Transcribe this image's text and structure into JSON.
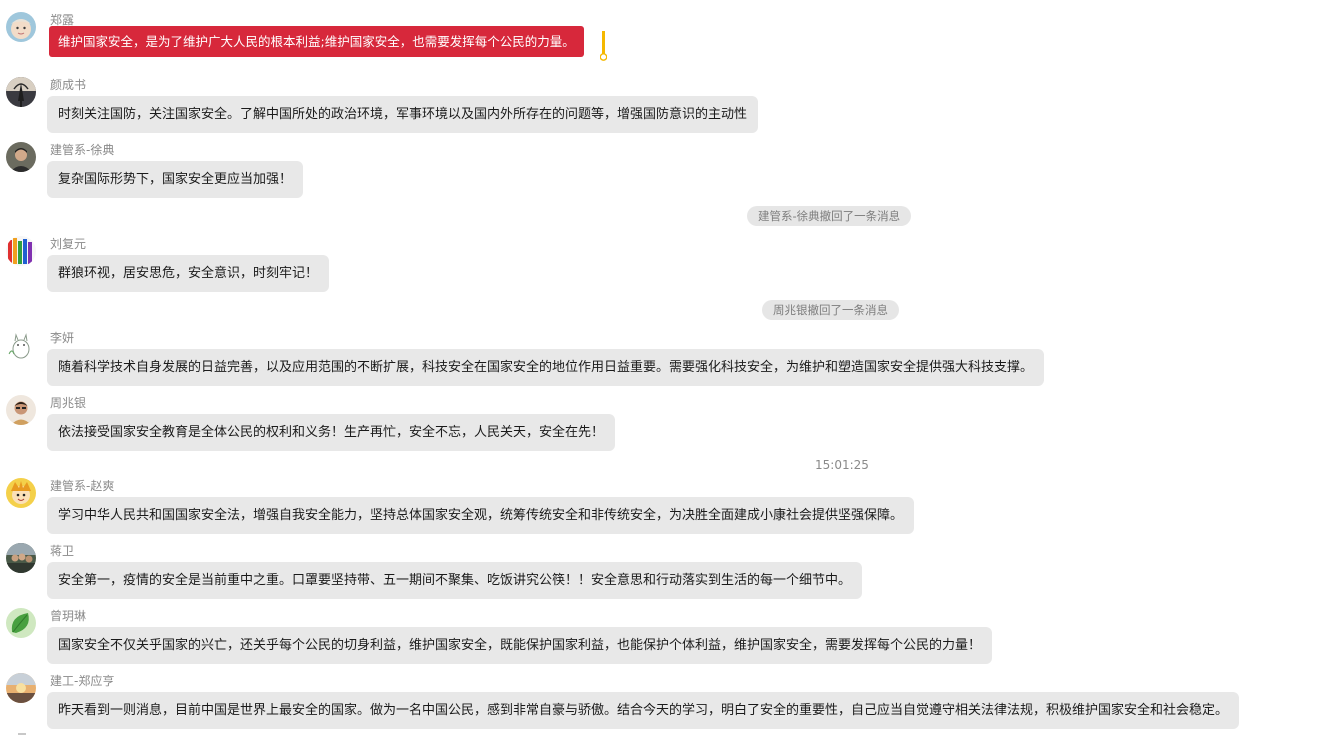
{
  "messages": [
    {
      "sender": "郑露",
      "text": "维护国家安全，是为了维护广大人民的根本利益;维护国家安全，也需要发挥每个公民的力量。",
      "avatar_icon": "baby-face-avatar-icon"
    },
    {
      "sender": "颜成书",
      "text": "时刻关注国防，关注国家安全。了解中国所处的政治环境，军事环境以及国内外所存在的问题等，增强国防意识的主动性",
      "avatar_icon": "tree-avatar-icon"
    },
    {
      "sender": "建管系-徐典",
      "text": "复杂国际形势下，国家安全更应当加强！",
      "avatar_icon": "person-photo-avatar-icon"
    },
    {
      "sender": "刘复元",
      "text": "群狼环视，居安思危，安全意识，时刻牢记！",
      "avatar_icon": "colorful-pencils-avatar-icon"
    },
    {
      "sender": "李妍",
      "text": "随着科学技术自身发展的日益完善，以及应用范围的不断扩展，科技安全在国家安全的地位作用日益重要。需要强化科技安全，为维护和塑造国家安全提供强大科技支撑。",
      "avatar_icon": "totoro-avatar-icon"
    },
    {
      "sender": "周兆银",
      "text": "依法接受国家安全教育是全体公民的权利和义务！生产再忙，安全不忘，人民关天，安全在先！",
      "avatar_icon": "portrait-avatar-icon"
    },
    {
      "sender": "建管系-赵爽",
      "text": "学习中华人民共和国国家安全法，增强自我安全能力，坚持总体国家安全观，统筹传统安全和非传统安全，为决胜全面建成小康社会提供坚强保障。",
      "avatar_icon": "cartoon-character-avatar-icon"
    },
    {
      "sender": "蒋卫",
      "text": "安全第一，疫情的安全是当前重中之重。口罩要坚持带、五一期间不聚集、吃饭讲究公筷！！安全意思和行动落实到生活的每一个细节中。",
      "avatar_icon": "group-photo-avatar-icon"
    },
    {
      "sender": "曾玥琳",
      "text": "国家安全不仅关乎国家的兴亡，还关乎每个公民的切身利益，维护国家安全，既能保护国家利益，也能保护个体利益，维护国家安全，需要发挥每个公民的力量！",
      "avatar_icon": "green-leaf-avatar-icon"
    },
    {
      "sender": "建工-郑应亨",
      "text": "昨天看到一则消息，目前中国是世界上最安全的国家。做为一名中国公民，感到非常自豪与骄傲。结合今天的学习，明白了安全的重要性，自己应当自觉遵守相关法律法规，积极维护国家安全和社会稳定。",
      "avatar_icon": "sunset-avatar-icon"
    }
  ],
  "notices": [
    {
      "text": "建管系-徐典撤回了一条消息"
    },
    {
      "text": "周兆银撤回了一条消息"
    }
  ],
  "timestamp": "15:01:25",
  "colors": {
    "bubble_bg": "#e8e8e8",
    "highlight_bg": "#d7283b",
    "highlight_marker": "#f5b800",
    "sender_text": "#8a8a8a",
    "notice_bg": "#e6e6e6"
  }
}
